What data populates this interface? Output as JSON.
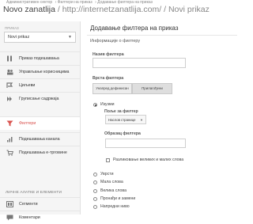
{
  "breadcrumb": [
    "Административен сектор",
    "Филтери на приказ",
    "Додавање филтера на приказ"
  ],
  "header": {
    "title": "Novo zanatlija",
    "subtitle": " / http://internetzanatlija.com/ / Novi prikaz"
  },
  "sidebar": {
    "view_label": "ПРИКАЗ",
    "view_select": "Novi prikaz",
    "items": [
      {
        "label": "Приказ подешавања",
        "icon": "settings-icon"
      },
      {
        "label": "Управљање корисницима",
        "icon": "users-icon"
      },
      {
        "label": "Циљеви",
        "icon": "goals-icon"
      },
      {
        "label": "Груписање садржаја",
        "icon": "content-grouping-icon"
      },
      {
        "label": "Филтери",
        "icon": "filter-icon"
      },
      {
        "label": "Подешавања канала",
        "icon": "channel-icon"
      },
      {
        "label": "Подешавања е-трговине",
        "icon": "cart-icon"
      }
    ],
    "section_label": "ЛИЧНЕ АЛАТКЕ И ЕЛЕМЕНТИ",
    "items2": [
      {
        "label": "Сегменти",
        "icon": "segments-icon"
      },
      {
        "label": "Коментари",
        "icon": "comments-icon"
      }
    ]
  },
  "main": {
    "page_title": "Додавање филтера на приказ",
    "info_label": "Информације о филтеру",
    "name_label": "Назив филтера",
    "name_value": "",
    "type_label": "Врста филтера",
    "tabs": [
      "Унапред дефинисан",
      "Прилагођени"
    ],
    "radio_exclude": "Изузми",
    "field_label": "Поље за филтер",
    "field_value": "Наслов странице",
    "pattern_label": "Образац филтера",
    "pattern_value": "",
    "case_label": "Разликовање великих и малих слова",
    "options": [
      "Уврсти",
      "Мала слова",
      "Велика слова",
      "Пронађи и замени",
      "Напредни ниво"
    ]
  },
  "colors": {
    "accent": "#d9534f",
    "sidebar_bg": "#f5f5f5"
  }
}
